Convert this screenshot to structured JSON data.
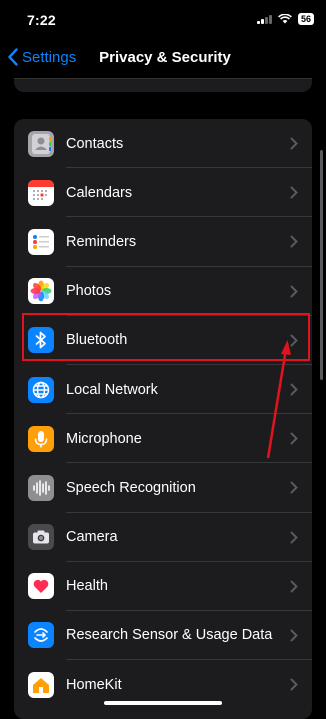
{
  "status_bar": {
    "time": "7:22",
    "battery": "56"
  },
  "nav": {
    "back_label": "Settings",
    "title": "Privacy & Security"
  },
  "items": [
    {
      "label": "Contacts",
      "icon": "contacts-icon",
      "color": "#8e8e93"
    },
    {
      "label": "Calendars",
      "icon": "calendar-icon",
      "color": "#ffffff"
    },
    {
      "label": "Reminders",
      "icon": "reminders-icon",
      "color": "#ffffff"
    },
    {
      "label": "Photos",
      "icon": "photos-icon",
      "color": "#ffffff"
    },
    {
      "label": "Bluetooth",
      "icon": "bluetooth-icon",
      "color": "#0a84ff"
    },
    {
      "label": "Local Network",
      "icon": "globe-icon",
      "color": "#0a84ff"
    },
    {
      "label": "Microphone",
      "icon": "microphone-icon",
      "color": "#ff9f0a"
    },
    {
      "label": "Speech Recognition",
      "icon": "waveform-icon",
      "color": "#8e8e93"
    },
    {
      "label": "Camera",
      "icon": "camera-icon",
      "color": "#3a3a3c"
    },
    {
      "label": "Health",
      "icon": "heart-icon",
      "color": "#ffffff"
    },
    {
      "label": "Research Sensor & Usage Data",
      "icon": "research-icon",
      "color": "#0a84ff"
    },
    {
      "label": "HomeKit",
      "icon": "home-icon",
      "color": "#ffffff"
    }
  ],
  "annotation": {
    "highlight_color": "#e0141e",
    "highlighted_item": "Bluetooth"
  }
}
